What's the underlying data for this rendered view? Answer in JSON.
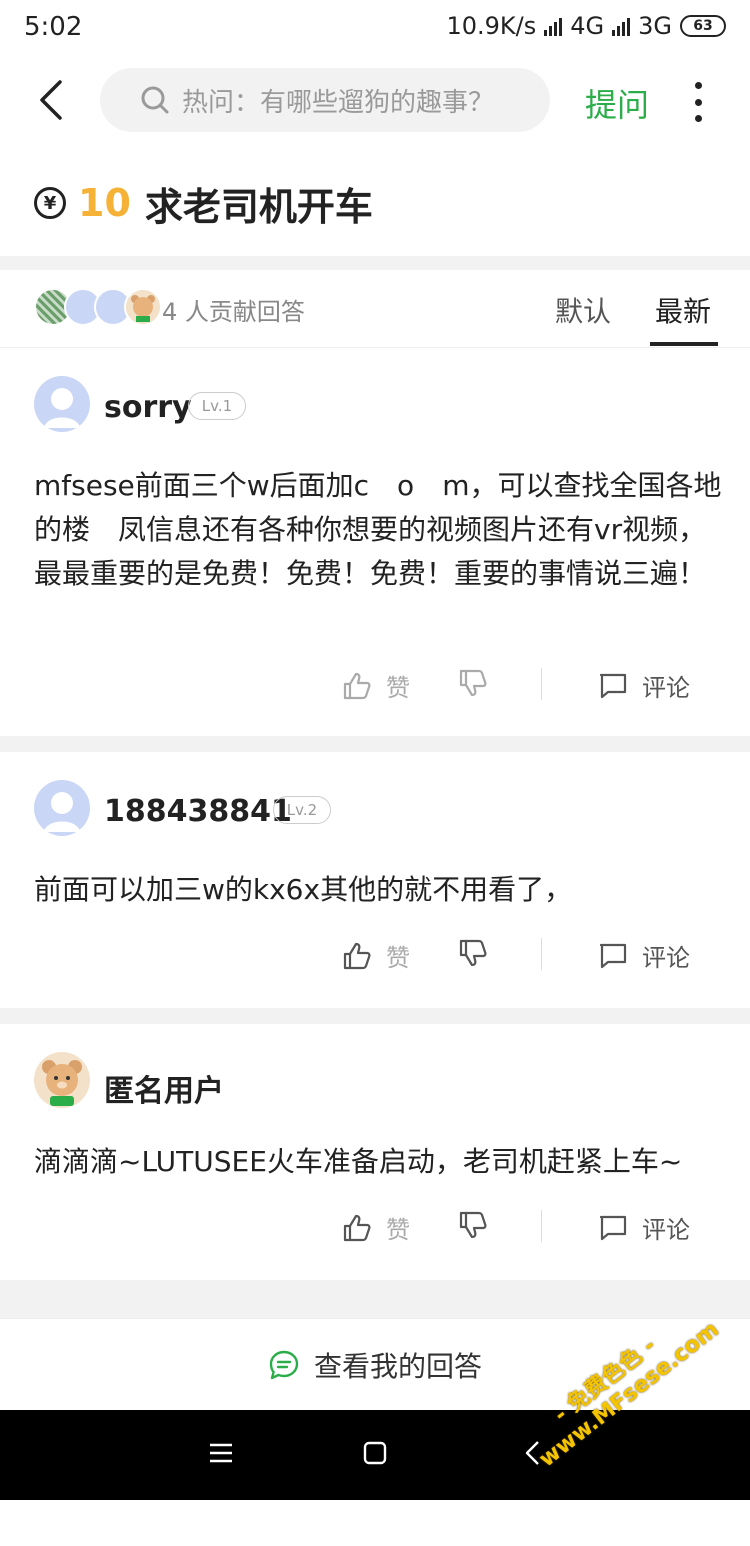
{
  "status_bar": {
    "time": "5:02",
    "speed": "10.9K/s",
    "net1": "4G",
    "net2": "3G",
    "battery": "63"
  },
  "top_bar": {
    "search_placeholder": "热问：有哪些遛狗的趣事？",
    "ask_label": "提问"
  },
  "question": {
    "currency_symbol": "¥",
    "bounty": "10",
    "title": "求老司机开车"
  },
  "answers_header": {
    "contributors": "4 人贡献回答",
    "tabs": [
      {
        "label": "默认",
        "active": false
      },
      {
        "label": "最新",
        "active": true
      }
    ]
  },
  "answers": [
    {
      "author": "sorry",
      "level": "Lv.1",
      "body": "mfsese前面三个w后面加c　o　m，可以查找全国各地的楼　凤信息还有各种你想要的视频图片还有vr视频，最最重要的是免费！免费！免费！重要的事情说三遍！",
      "like_label": "赞",
      "comment_label": "评论"
    },
    {
      "author": "188438841",
      "level": "Lv.2",
      "body": "前面可以加三w的kx6x其他的就不用看了，",
      "like_label": "赞",
      "comment_label": "评论"
    },
    {
      "author": "匿名用户",
      "level": "",
      "body": "滴滴滴~LUTUSEE火车准备启动，老司机赶紧上车~",
      "like_label": "赞",
      "comment_label": "评论"
    }
  ],
  "bottom_cta": {
    "label": "查看我的回答"
  },
  "watermark": {
    "line1": "- 免费色色 -",
    "line2": "www.MFsese.com"
  },
  "colors": {
    "accent_green": "#2bae4a",
    "bounty_gold": "#f5b237",
    "divider_gray": "#f2f2f2"
  }
}
